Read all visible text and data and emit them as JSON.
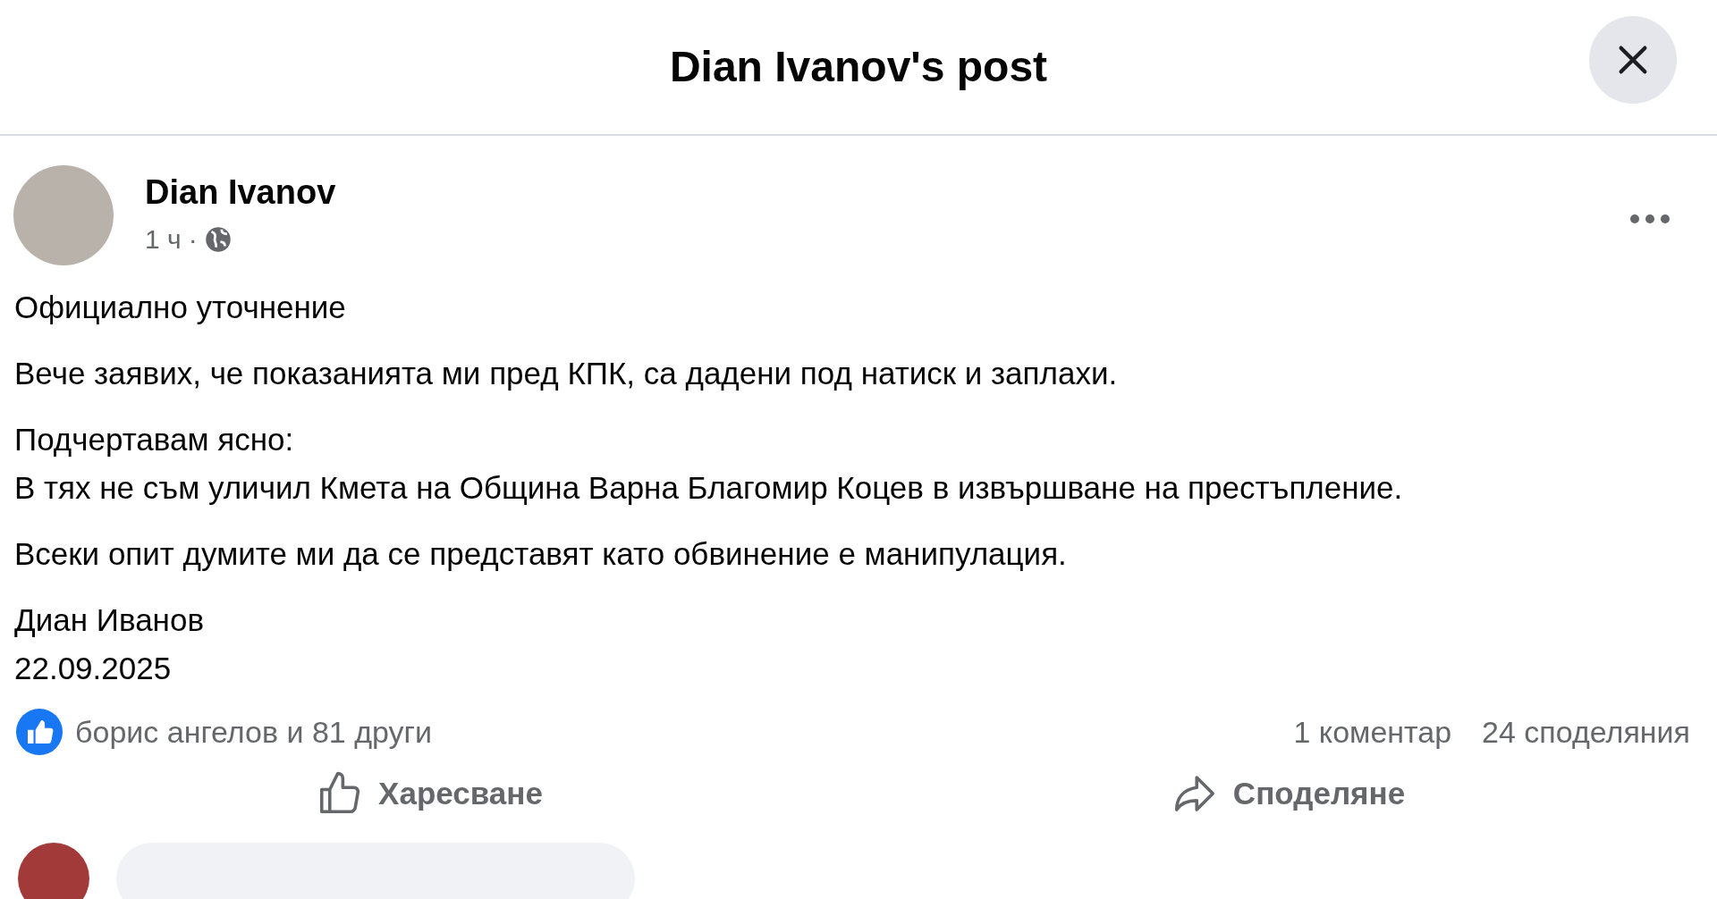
{
  "dialog": {
    "title": "Dian Ivanov's post"
  },
  "post": {
    "author": "Dian Ivanov",
    "time": "1 ч",
    "separator": "·",
    "paragraphs": [
      [
        "Официално уточнение"
      ],
      [
        "Вече заявих, че показанията ми пред КПК, са дадени под натиск и заплахи."
      ],
      [
        "Подчертавам ясно:",
        "В тях не съм уличил Кмета на Община Варна Благомир Коцев в извършване на престъпление."
      ],
      [
        "Всеки опит думите ми да се представят като обвинение е манипулация."
      ],
      [
        "Диан Иванов",
        "22.09.2025"
      ]
    ],
    "reactions": "борис ангелов и 81 други",
    "comments": "1 коментар",
    "shares": "24 споделяния",
    "actions": [
      {
        "kind": "like",
        "label": "Харесване"
      },
      {
        "kind": "share",
        "label": "Споделяне"
      }
    ]
  }
}
